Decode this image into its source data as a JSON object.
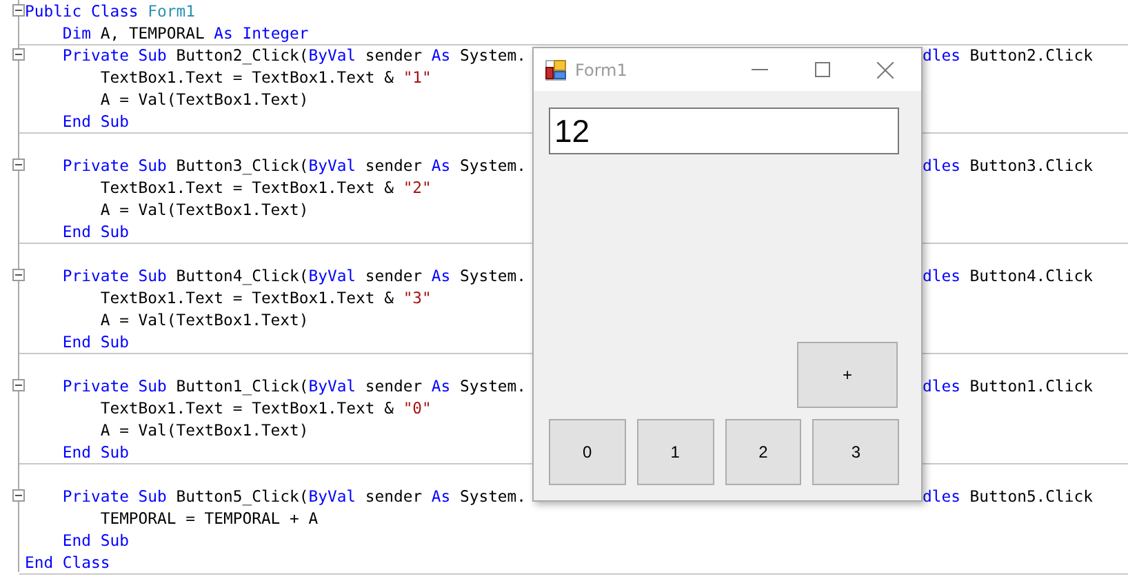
{
  "editor": {
    "blocks": [
      {
        "lines": [
          {
            "foldable": true,
            "left": [
              {
                "kind": "keyword",
                "text": "Public Class "
              },
              {
                "kind": "type",
                "text": "Form1"
              }
            ]
          },
          {
            "foldable": false,
            "left": [
              {
                "kind": "keyword",
                "text": "    Dim"
              },
              {
                "kind": "plain",
                "text": " A, TEMPORAL "
              },
              {
                "kind": "keyword",
                "text": "As Integer"
              }
            ]
          }
        ]
      },
      {
        "lines": [
          {
            "foldable": true,
            "left": [
              {
                "kind": "keyword",
                "text": "    Private Sub"
              },
              {
                "kind": "plain",
                "text": " Button2_Click("
              },
              {
                "kind": "keyword",
                "text": "ByVal"
              },
              {
                "kind": "plain",
                "text": " sender "
              },
              {
                "kind": "keyword",
                "text": "As"
              },
              {
                "kind": "plain",
                "text": " System."
              }
            ],
            "right": [
              {
                "kind": "keyword",
                "text": "dles"
              },
              {
                "kind": "plain",
                "text": " Button2.Click"
              }
            ]
          },
          {
            "foldable": false,
            "left": [
              {
                "kind": "plain",
                "text": "        TextBox1.Text = TextBox1.Text & "
              },
              {
                "kind": "string",
                "text": "\"1\""
              }
            ]
          },
          {
            "foldable": false,
            "left": [
              {
                "kind": "plain",
                "text": "        A = Val(TextBox1.Text)"
              }
            ]
          },
          {
            "foldable": false,
            "left": [
              {
                "kind": "keyword",
                "text": "    End Sub"
              }
            ]
          }
        ]
      },
      {
        "lines": [
          {
            "foldable": false
          },
          {
            "foldable": true,
            "left": [
              {
                "kind": "keyword",
                "text": "    Private Sub"
              },
              {
                "kind": "plain",
                "text": " Button3_Click("
              },
              {
                "kind": "keyword",
                "text": "ByVal"
              },
              {
                "kind": "plain",
                "text": " sender "
              },
              {
                "kind": "keyword",
                "text": "As"
              },
              {
                "kind": "plain",
                "text": " System."
              }
            ],
            "right": [
              {
                "kind": "keyword",
                "text": "dles"
              },
              {
                "kind": "plain",
                "text": " Button3.Click"
              }
            ]
          },
          {
            "foldable": false,
            "left": [
              {
                "kind": "plain",
                "text": "        TextBox1.Text = TextBox1.Text & "
              },
              {
                "kind": "string",
                "text": "\"2\""
              }
            ]
          },
          {
            "foldable": false,
            "left": [
              {
                "kind": "plain",
                "text": "        A = Val(TextBox1.Text)"
              }
            ]
          },
          {
            "foldable": false,
            "left": [
              {
                "kind": "keyword",
                "text": "    End Sub"
              }
            ]
          }
        ]
      },
      {
        "lines": [
          {
            "foldable": false
          },
          {
            "foldable": true,
            "left": [
              {
                "kind": "keyword",
                "text": "    Private Sub"
              },
              {
                "kind": "plain",
                "text": " Button4_Click("
              },
              {
                "kind": "keyword",
                "text": "ByVal"
              },
              {
                "kind": "plain",
                "text": " sender "
              },
              {
                "kind": "keyword",
                "text": "As"
              },
              {
                "kind": "plain",
                "text": " System."
              }
            ],
            "right": [
              {
                "kind": "keyword",
                "text": "dles"
              },
              {
                "kind": "plain",
                "text": " Button4.Click"
              }
            ]
          },
          {
            "foldable": false,
            "left": [
              {
                "kind": "plain",
                "text": "        TextBox1.Text = TextBox1.Text & "
              },
              {
                "kind": "string",
                "text": "\"3\""
              }
            ]
          },
          {
            "foldable": false,
            "left": [
              {
                "kind": "plain",
                "text": "        A = Val(TextBox1.Text)"
              }
            ]
          },
          {
            "foldable": false,
            "left": [
              {
                "kind": "keyword",
                "text": "    End Sub"
              }
            ]
          }
        ]
      },
      {
        "lines": [
          {
            "foldable": false
          },
          {
            "foldable": true,
            "left": [
              {
                "kind": "keyword",
                "text": "    Private Sub"
              },
              {
                "kind": "plain",
                "text": " Button1_Click("
              },
              {
                "kind": "keyword",
                "text": "ByVal"
              },
              {
                "kind": "plain",
                "text": " sender "
              },
              {
                "kind": "keyword",
                "text": "As"
              },
              {
                "kind": "plain",
                "text": " System."
              }
            ],
            "right": [
              {
                "kind": "keyword",
                "text": "dles"
              },
              {
                "kind": "plain",
                "text": " Button1.Click"
              }
            ]
          },
          {
            "foldable": false,
            "left": [
              {
                "kind": "plain",
                "text": "        TextBox1.Text = TextBox1.Text & "
              },
              {
                "kind": "string",
                "text": "\"0\""
              }
            ]
          },
          {
            "foldable": false,
            "left": [
              {
                "kind": "plain",
                "text": "        A = Val(TextBox1.Text)"
              }
            ]
          },
          {
            "foldable": false,
            "left": [
              {
                "kind": "keyword",
                "text": "    End Sub"
              }
            ]
          }
        ]
      },
      {
        "lines": [
          {
            "foldable": false
          },
          {
            "foldable": true,
            "left": [
              {
                "kind": "keyword",
                "text": "    Private Sub"
              },
              {
                "kind": "plain",
                "text": " Button5_Click("
              },
              {
                "kind": "keyword",
                "text": "ByVal"
              },
              {
                "kind": "plain",
                "text": " sender "
              },
              {
                "kind": "keyword",
                "text": "As"
              },
              {
                "kind": "plain",
                "text": " System."
              }
            ],
            "right": [
              {
                "kind": "keyword",
                "text": "dles"
              },
              {
                "kind": "plain",
                "text": " Button5.Click"
              }
            ]
          },
          {
            "foldable": false,
            "left": [
              {
                "kind": "plain",
                "text": "        TEMPORAL = TEMPORAL + A"
              }
            ]
          },
          {
            "foldable": false,
            "left": [
              {
                "kind": "keyword",
                "text": "    End Sub"
              }
            ]
          },
          {
            "foldable": false,
            "left": [
              {
                "kind": "keyword",
                "text": "End Class"
              }
            ]
          }
        ]
      }
    ]
  },
  "form_window": {
    "title": "Form1",
    "textbox": {
      "value": "12"
    },
    "top_buttons": [
      "+"
    ],
    "bottom_buttons": [
      "0",
      "1",
      "2",
      "3"
    ]
  }
}
